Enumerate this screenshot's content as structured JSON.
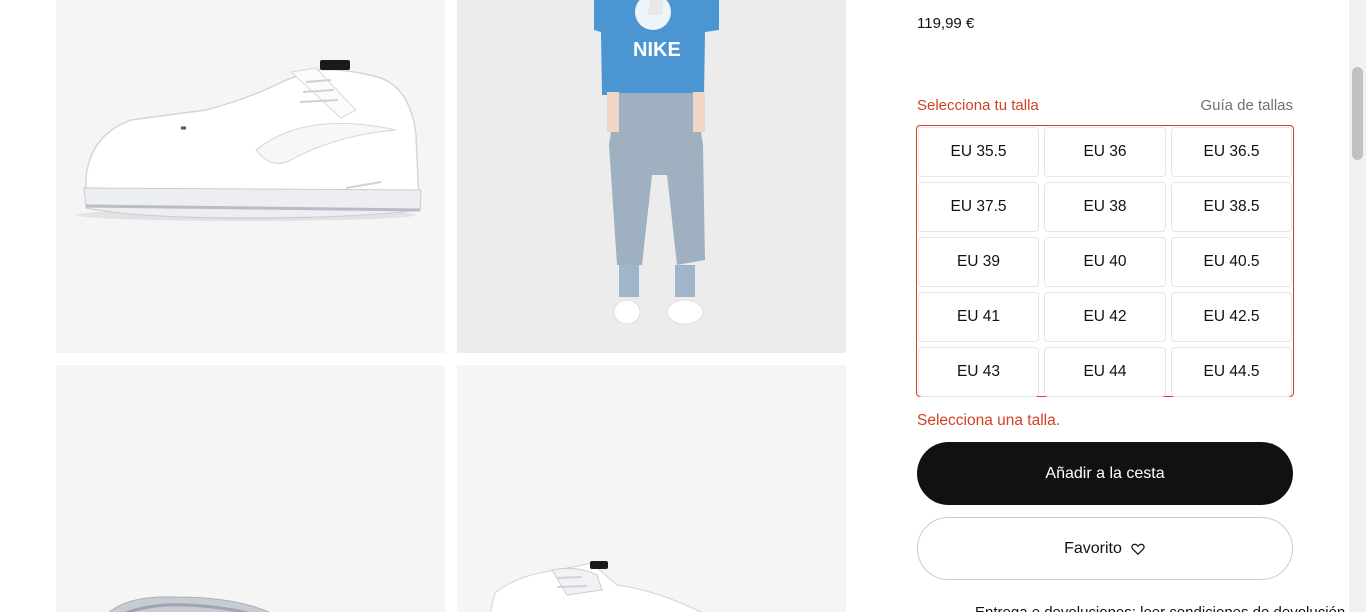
{
  "product": {
    "price": "119,99 €"
  },
  "sizes": {
    "label": "Selecciona tu talla",
    "guide": "Guía de tallas",
    "options": [
      "EU 35.5",
      "EU 36",
      "EU 36.5",
      "EU 37.5",
      "EU 38",
      "EU 38.5",
      "EU 39",
      "EU 40",
      "EU 40.5",
      "EU 41",
      "EU 42",
      "EU 42.5",
      "EU 43",
      "EU 44",
      "EU 44.5"
    ],
    "error": "Selecciona una talla."
  },
  "actions": {
    "add_to_bag": "Añadir a la cesta",
    "favorite": "Favorito",
    "favorite_icon": "heart-outline-icon"
  },
  "gallery": {
    "images": [
      {
        "subject": "white sneaker side view"
      },
      {
        "subject": "model wearing blue tee and grey pants"
      },
      {
        "subject": "sneaker sole bottom view"
      },
      {
        "subject": "sneaker top view"
      }
    ],
    "tshirt_print": "NIKE"
  },
  "footer_partial": "Entrega e devoluciones: leer condiciones de devolución",
  "colors": {
    "error": "#d43f21",
    "primary": "#111111"
  }
}
